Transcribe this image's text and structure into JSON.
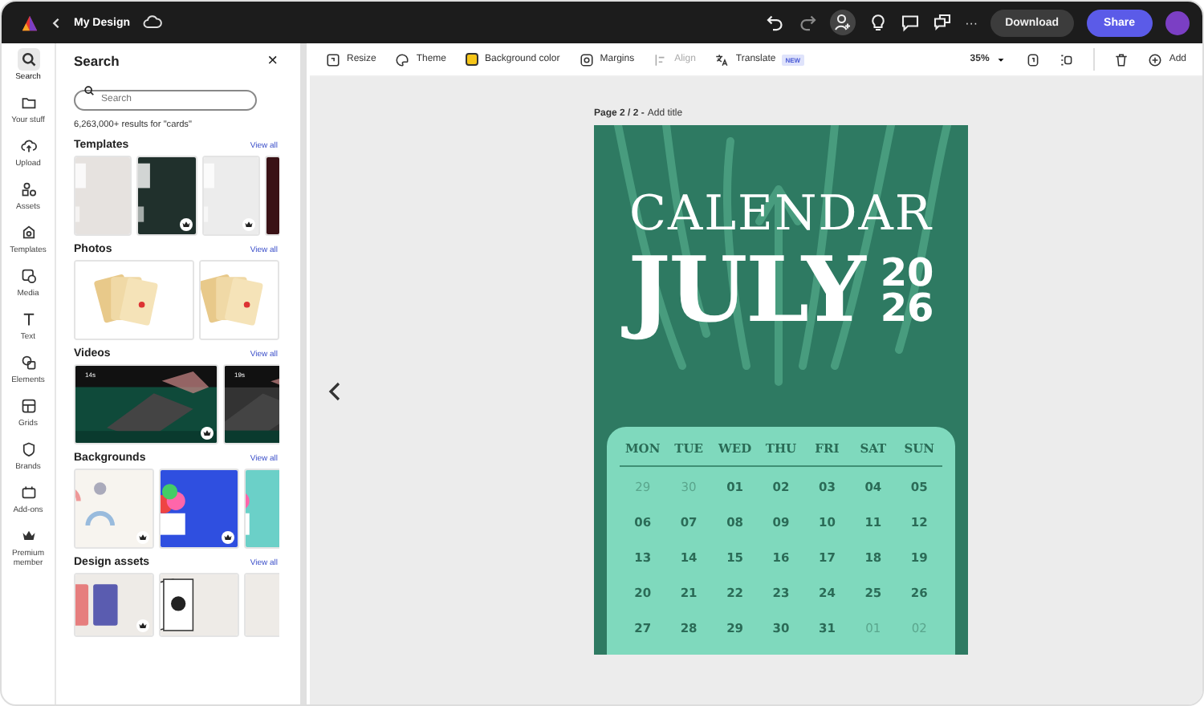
{
  "top_bar": {
    "title": "My Design",
    "more": "···",
    "download": "Download",
    "share": "Share"
  },
  "rail": [
    {
      "label": "Search",
      "selected": true
    },
    {
      "label": "Your stuff",
      "selected": false
    },
    {
      "label": "Upload",
      "selected": false
    },
    {
      "label": "Assets",
      "selected": false
    },
    {
      "label": "Templates",
      "selected": false
    },
    {
      "label": "Media",
      "selected": false
    },
    {
      "label": "Text",
      "selected": false
    },
    {
      "label": "Elements",
      "selected": false
    },
    {
      "label": "Grids",
      "selected": false
    },
    {
      "label": "Brands",
      "selected": false
    },
    {
      "label": "Add-ons",
      "selected": false
    },
    {
      "label": "Premium member",
      "selected": false
    }
  ],
  "panel": {
    "title": "Search",
    "close": "×",
    "search": {
      "placeholder": "Search"
    },
    "results": "6,263,000+ results for \"cards\"",
    "sections": [
      {
        "title": "Templates",
        "view_all": "View all",
        "items": [
          {
            "kind": "picture",
            "premium": false
          },
          {
            "kind": "picture",
            "premium": true
          },
          {
            "kind": "picture",
            "premium": true
          },
          {
            "kind": "picture",
            "premium": false
          }
        ]
      },
      {
        "title": "Photos",
        "view_all": "View all",
        "items": [
          {
            "kind": "picture",
            "premium": false
          },
          {
            "kind": "picture",
            "premium": false
          }
        ]
      },
      {
        "title": "Videos",
        "view_all": "View all",
        "items": [
          {
            "kind": "picture",
            "premium": true,
            "duration": "14s"
          },
          {
            "kind": "picture",
            "premium": false,
            "duration": "19s"
          }
        ]
      },
      {
        "title": "Backgrounds",
        "view_all": "View all",
        "items": [
          {
            "kind": "picture",
            "premium": true
          },
          {
            "kind": "picture",
            "premium": true
          },
          {
            "kind": "picture",
            "premium": false
          }
        ]
      },
      {
        "title": "Design assets",
        "view_all": "View all",
        "items": [
          {
            "kind": "picture",
            "premium": true
          },
          {
            "kind": "picture",
            "premium": false
          },
          {
            "kind": "picture",
            "premium": false
          }
        ]
      }
    ]
  },
  "toolbar": {
    "items": [
      {
        "label": "Resize",
        "disabled": false
      },
      {
        "label": "Theme",
        "disabled": false
      },
      {
        "label": "Background color",
        "disabled": false,
        "color": "#f5c518"
      },
      {
        "label": "Margins",
        "disabled": false
      },
      {
        "label": "Align",
        "disabled": true
      },
      {
        "label": "Translate",
        "disabled": false,
        "badge": "NEW"
      }
    ],
    "zoom": "35%",
    "add": "Add"
  },
  "canvas": {
    "page_label": "Page 2 / 2 -",
    "page_title_placeholder": "Add title",
    "calendar": {
      "title": "CALENDAR",
      "month": "JULY",
      "year": [
        "20",
        "26"
      ],
      "weekdays": [
        "MON",
        "TUE",
        "WED",
        "THU",
        "FRI",
        "SAT",
        "SUN"
      ],
      "weeks": [
        [
          {
            "day": "29",
            "muted": true
          },
          {
            "day": "30",
            "muted": true
          },
          {
            "day": "01",
            "muted": false
          },
          {
            "day": "02",
            "muted": false
          },
          {
            "day": "03",
            "muted": false
          },
          {
            "day": "04",
            "muted": false
          },
          {
            "day": "05",
            "muted": false
          }
        ],
        [
          {
            "day": "06",
            "muted": false
          },
          {
            "day": "07",
            "muted": false
          },
          {
            "day": "08",
            "muted": false
          },
          {
            "day": "09",
            "muted": false
          },
          {
            "day": "10",
            "muted": false
          },
          {
            "day": "11",
            "muted": false
          },
          {
            "day": "12",
            "muted": false
          }
        ],
        [
          {
            "day": "13",
            "muted": false
          },
          {
            "day": "14",
            "muted": false
          },
          {
            "day": "15",
            "muted": false
          },
          {
            "day": "16",
            "muted": false
          },
          {
            "day": "17",
            "muted": false
          },
          {
            "day": "18",
            "muted": false
          },
          {
            "day": "19",
            "muted": false
          }
        ],
        [
          {
            "day": "20",
            "muted": false
          },
          {
            "day": "21",
            "muted": false
          },
          {
            "day": "22",
            "muted": false
          },
          {
            "day": "23",
            "muted": false
          },
          {
            "day": "24",
            "muted": false
          },
          {
            "day": "25",
            "muted": false
          },
          {
            "day": "26",
            "muted": false
          }
        ],
        [
          {
            "day": "27",
            "muted": false
          },
          {
            "day": "28",
            "muted": false
          },
          {
            "day": "29",
            "muted": false
          },
          {
            "day": "30",
            "muted": false
          },
          {
            "day": "31",
            "muted": false
          },
          {
            "day": "01",
            "muted": true
          },
          {
            "day": "02",
            "muted": true
          }
        ]
      ]
    }
  }
}
